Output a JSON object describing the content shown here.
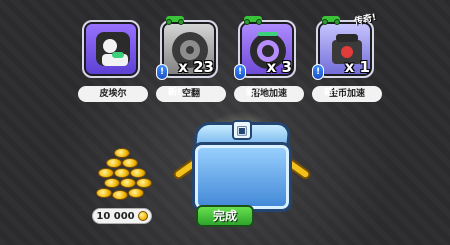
{
  "rewards": [
    {
      "label": "皮埃尔",
      "count": "",
      "badge_text": "",
      "new": false
    },
    {
      "label": "空翻",
      "count": "x 23",
      "badge_text": "新!",
      "new": true
    },
    {
      "label": "落地加速",
      "count": "x 3",
      "badge_text": "新!",
      "new": true
    },
    {
      "label": "金币加速",
      "count": "x 1",
      "badge_text": "新!",
      "new": true,
      "corner_tag": "传奇!"
    }
  ],
  "coins": {
    "total": "10 000"
  },
  "buttons": {
    "done": "完成"
  },
  "colors": {
    "accent_green": "#2ea52b",
    "badge_blue": "#1b53c7",
    "coin_gold": "#f2b705"
  },
  "icons": {
    "reward_new_marker": "exclamation-badge-icon",
    "reward_vehicle_marker": "green-bike-icon",
    "currency": "coin-icon",
    "chest": "blue-treasure-chest-icon"
  }
}
